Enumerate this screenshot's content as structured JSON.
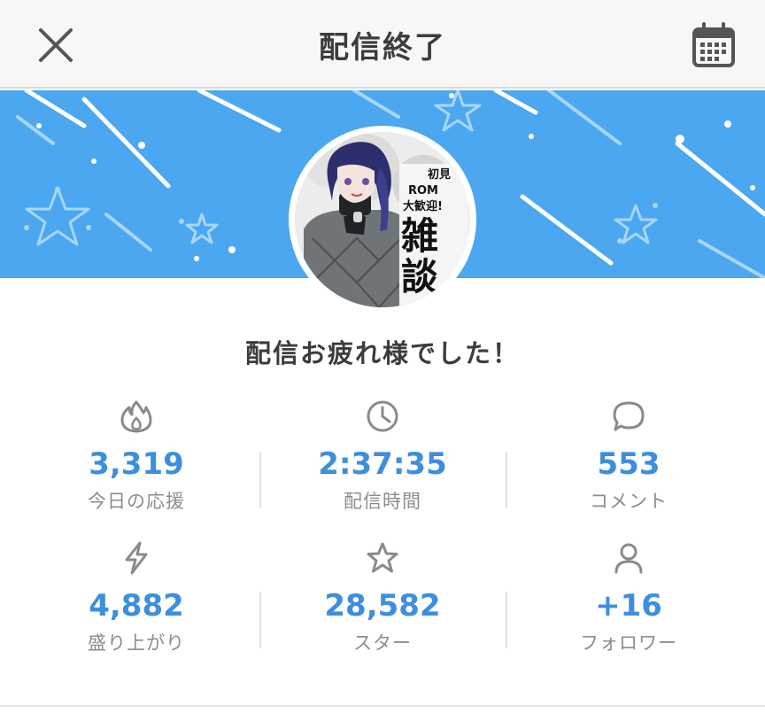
{
  "header": {
    "title": "配信終了",
    "close_icon": "close-icon",
    "calendar_icon": "calendar-icon"
  },
  "banner": {
    "background": "#4aa7f0"
  },
  "avatar": {
    "text_lines": [
      "初見",
      "ROM",
      "大歓迎!",
      "雑",
      "談"
    ]
  },
  "message": "配信お疲れ様でした！",
  "stats": [
    {
      "icon": "flame-icon",
      "value": "3,319",
      "label": "今日の応援"
    },
    {
      "icon": "clock-icon",
      "value": "2:37:35",
      "label": "配信時間"
    },
    {
      "icon": "comment-icon",
      "value": "553",
      "label": "コメント"
    },
    {
      "icon": "lightning-icon",
      "value": "4,882",
      "label": "盛り上がり"
    },
    {
      "icon": "star-icon",
      "value": "28,582",
      "label": "スター"
    },
    {
      "icon": "user-icon",
      "value": "+16",
      "label": "フォロワー"
    }
  ],
  "colors": {
    "accent": "#3d8fde",
    "label": "#8c8c8c",
    "icon": "#8a8a8a"
  }
}
